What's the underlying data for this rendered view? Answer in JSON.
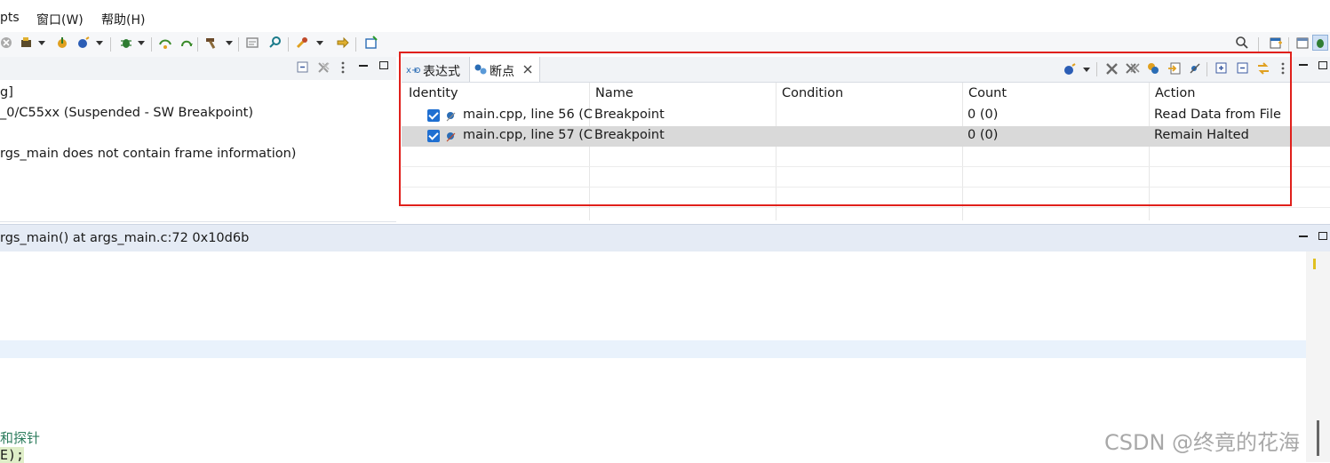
{
  "menubar": {
    "items": [
      "pts",
      "窗口(W)",
      "帮助(H)"
    ]
  },
  "debug": {
    "lines": [
      "g]",
      "_0/C55xx (Suspended - SW Breakpoint)",
      "rgs_main does not contain frame information)"
    ]
  },
  "breakpoints_view": {
    "tabs": [
      {
        "label": "表达式",
        "icon": "expressions-icon"
      },
      {
        "label": "断点",
        "icon": "breakpoints-icon",
        "active": true
      }
    ],
    "columns": [
      "Identity",
      "Name",
      "Condition",
      "Count",
      "Action"
    ],
    "rows": [
      {
        "identity": "main.cpp, line 56 (C",
        "name": "Breakpoint",
        "condition": "",
        "count": "0 (0)",
        "action": "Read Data from File",
        "checked": true
      },
      {
        "identity": "main.cpp, line 57 (C",
        "name": "Breakpoint",
        "condition": "",
        "count": "0 (0)",
        "action": "Remain Halted",
        "checked": true,
        "selected": true
      }
    ]
  },
  "editor": {
    "title": "rgs_main() at args_main.c:72 0x10d6b",
    "code_lines": [
      "和探针",
      "E);"
    ]
  },
  "watermark": "CSDN @终竟的花海",
  "colors": {
    "highlight_box": "#e0201b",
    "checkbox": "#1f6fd1",
    "selected_row": "#d9d9d9"
  }
}
